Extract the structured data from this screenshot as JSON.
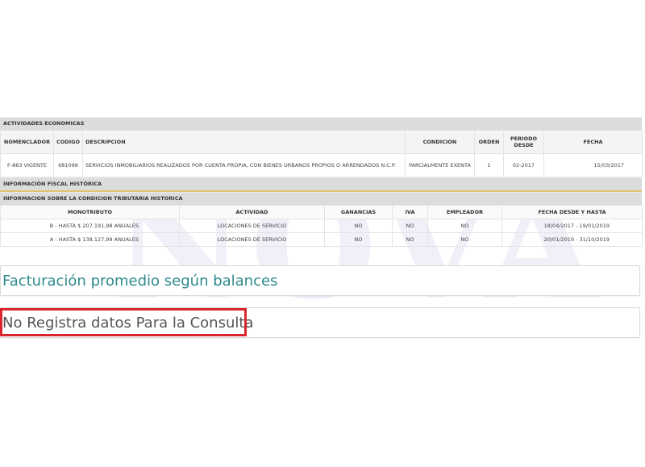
{
  "actividades": {
    "section_title": "ACTIVIDADES ECONOMICAS",
    "headers": {
      "nomenclador": "NOMENCLADOR",
      "codigo": "CODIGO",
      "descripcion": "DESCRIPCION",
      "condicion": "CONDICION",
      "orden": "ORDEN",
      "periodo_desde": "PERIODO DESDE",
      "fecha": "FECHA"
    },
    "rows": [
      {
        "nomenclador": "F-883 VIGENTE",
        "codigo": "681098",
        "descripcion": "SERVICIOS INMOBILIARIOS REALIZADOS POR CUENTA PROPIA, CON BIENES URBANOS PROPIOS O ARRENDADOS N.C.P.",
        "condicion": "PARCIALMENTE EXENTA",
        "orden": "1",
        "periodo_desde": "02-2017",
        "fecha": "15/03/2017"
      }
    ]
  },
  "info_fiscal": {
    "section_title": "INFORMACIÓN FISCAL HISTÓRICA"
  },
  "condicion_tributaria": {
    "section_title": "INFORMACION SOBRE LA CONDICION TRIBUTARIA HISTORICA",
    "headers": {
      "monotributo": "MONOTRIBUTO",
      "actividad": "ACTIVIDAD",
      "ganancias": "GANANCIAS",
      "iva": "IVA",
      "empleador": "EMPLEADOR",
      "fecha_desde_hasta": "FECHA DESDE Y HASTA"
    },
    "rows": [
      {
        "monotributo": "B - HASTA $ 207.191,98 ANUALES",
        "actividad": "LOCACIONES DE SERVICIO",
        "ganancias": "NO",
        "iva": "NO",
        "empleador": "NO",
        "fecha_desde_hasta": "18/04/2017 - 19/01/2019"
      },
      {
        "monotributo": "A - HASTA $ 138.127,99 ANUALES",
        "actividad": "LOCACIONES DE SERVICIO",
        "ganancias": "NO",
        "iva": "NO",
        "empleador": "NO",
        "fecha_desde_hasta": "20/01/2019 - 31/10/2019"
      }
    ]
  },
  "facturacion": {
    "title": "Facturación promedio según balances",
    "message": "No Registra datos Para la Consulta"
  },
  "watermark": "NOVA",
  "colors": {
    "section_bg": "#dcdcdc",
    "accent_teal": "#2e8a8c",
    "highlight_red": "#d9262c",
    "gold_rule": "#e2c36b"
  }
}
